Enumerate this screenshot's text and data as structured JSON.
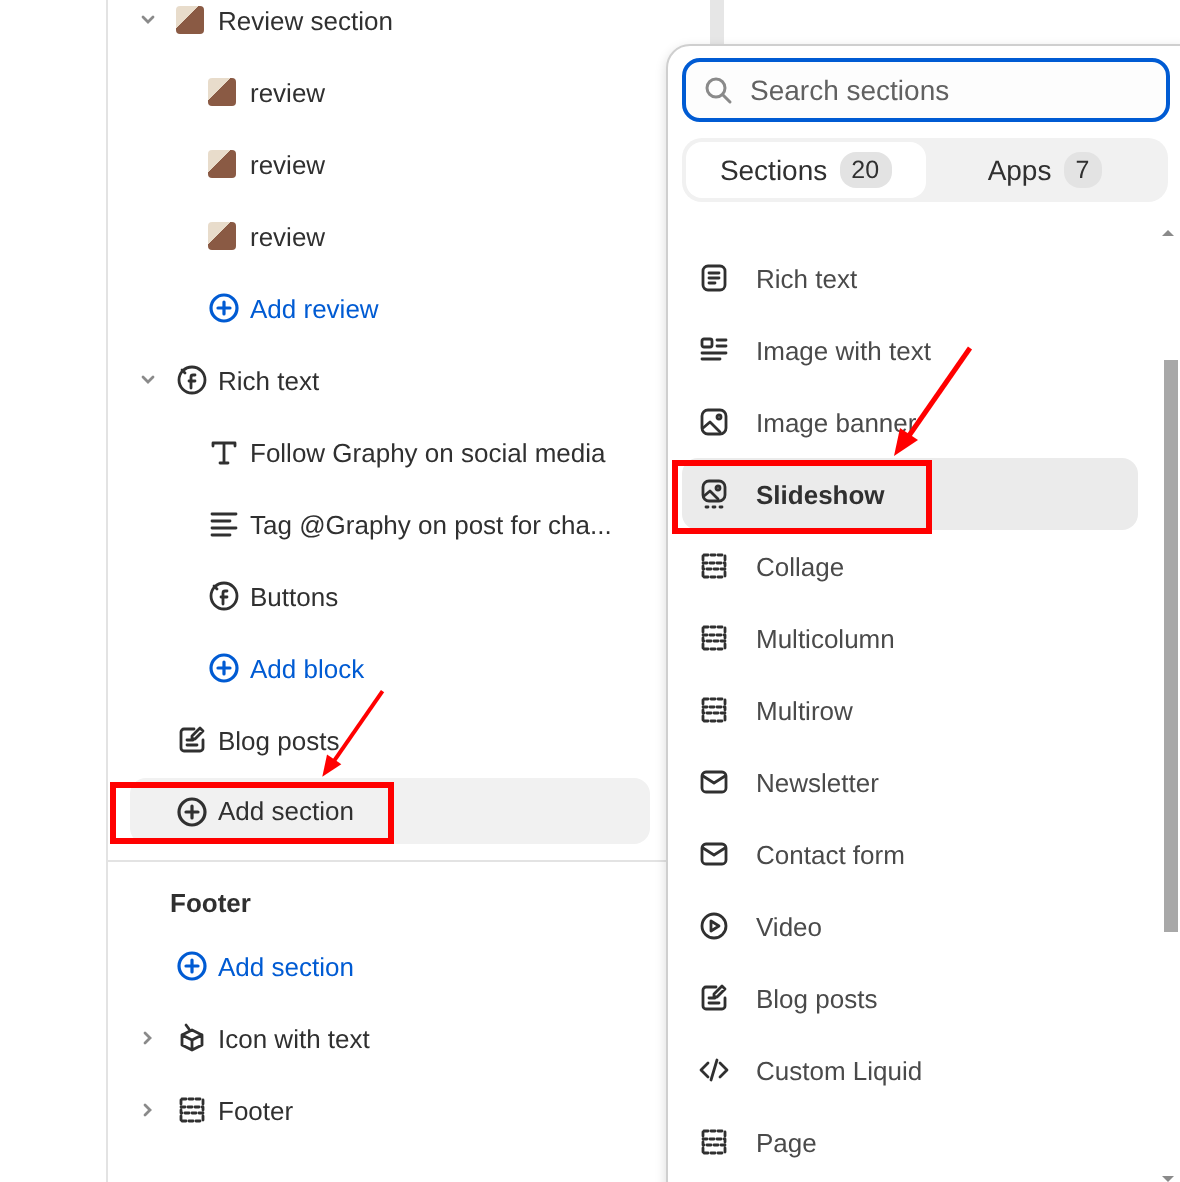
{
  "tree": [
    {
      "label": "Review section",
      "kind": "photo",
      "expanded": true,
      "children": [
        {
          "label": "review",
          "kind": "photo"
        },
        {
          "label": "review",
          "kind": "photo"
        },
        {
          "label": "review",
          "kind": "photo"
        },
        {
          "kind": "add",
          "label": "Add review"
        }
      ]
    },
    {
      "label": "Rich text",
      "kind": "social",
      "expanded": true,
      "children": [
        {
          "label": "Follow Graphy on social media",
          "kind": "heading"
        },
        {
          "label": "Tag @Graphy on post for cha...",
          "kind": "paragraph"
        },
        {
          "label": "Buttons",
          "kind": "social"
        },
        {
          "kind": "add",
          "label": "Add block"
        }
      ]
    },
    {
      "label": "Blog posts",
      "kind": "blog"
    },
    {
      "kind": "add",
      "label": "Add section",
      "selected": true,
      "annotated": true
    }
  ],
  "footer": {
    "heading": "Footer",
    "items": [
      {
        "kind": "add",
        "label": "Add section"
      },
      {
        "label": "Icon with text",
        "kind": "box",
        "expanded": false
      },
      {
        "label": "Footer",
        "kind": "layout",
        "expanded": false
      }
    ]
  },
  "popover": {
    "search": {
      "placeholder": "Search sections"
    },
    "tabs": [
      {
        "label": "Sections",
        "count": "20",
        "selected": true
      },
      {
        "label": "Apps",
        "count": "7",
        "selected": false
      }
    ],
    "items": [
      {
        "label": "Rich text",
        "kind": "text",
        "selected": false,
        "annotated": false
      },
      {
        "label": "Image with text",
        "kind": "imagetext",
        "selected": false,
        "annotated": false
      },
      {
        "label": "Image banner",
        "kind": "image",
        "selected": false,
        "annotated": false
      },
      {
        "label": "Slideshow",
        "kind": "slideshow",
        "selected": true,
        "annotated": true
      },
      {
        "label": "Collage",
        "kind": "layout",
        "selected": false,
        "annotated": false
      },
      {
        "label": "Multicolumn",
        "kind": "layout",
        "selected": false,
        "annotated": false
      },
      {
        "label": "Multirow",
        "kind": "layout",
        "selected": false,
        "annotated": false
      },
      {
        "label": "Newsletter",
        "kind": "mail",
        "selected": false,
        "annotated": false
      },
      {
        "label": "Contact form",
        "kind": "mail",
        "selected": false,
        "annotated": false
      },
      {
        "label": "Video",
        "kind": "play",
        "selected": false,
        "annotated": false
      },
      {
        "label": "Blog posts",
        "kind": "blog",
        "selected": false,
        "annotated": false
      },
      {
        "label": "Custom Liquid",
        "kind": "code",
        "selected": false,
        "annotated": false
      },
      {
        "label": "Page",
        "kind": "layout",
        "selected": false,
        "annotated": false
      }
    ]
  }
}
